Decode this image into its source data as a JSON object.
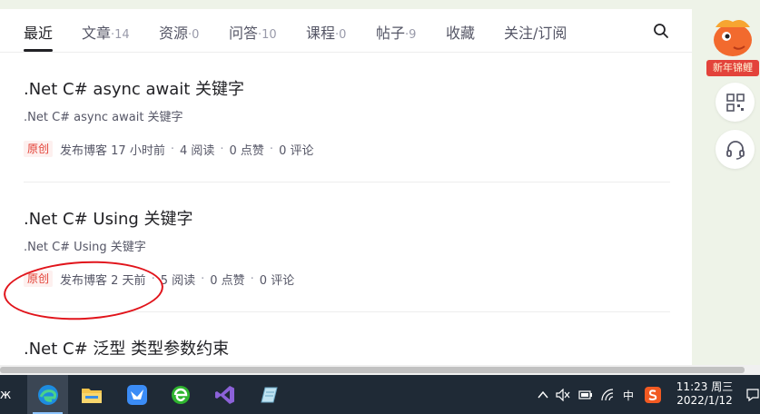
{
  "tabs": [
    {
      "label": "最近",
      "count": ""
    },
    {
      "label": "文章",
      "count": "·14"
    },
    {
      "label": "资源",
      "count": "·0"
    },
    {
      "label": "问答",
      "count": "·10"
    },
    {
      "label": "课程",
      "count": "·0"
    },
    {
      "label": "帖子",
      "count": "·9"
    },
    {
      "label": "收藏",
      "count": ""
    },
    {
      "label": "关注/订阅",
      "count": ""
    }
  ],
  "articles": [
    {
      "title": ".Net C# async await 关键字",
      "desc": ".Net C# async await 关键字",
      "badge": "原创",
      "published": "发布博客 17 小时前",
      "reads": "4 阅读",
      "likes": "0 点赞",
      "comments": "0 评论"
    },
    {
      "title": ".Net C# Using 关键字",
      "desc": ".Net C# Using 关键字",
      "badge": "原创",
      "published": "发布博客 2 天前",
      "reads": "5 阅读",
      "likes": "0 点赞",
      "comments": "0 评论"
    },
    {
      "title": ".Net C# 泛型 类型参数约束"
    }
  ],
  "side": {
    "promo_label": "新年锦鲤"
  },
  "taskbar": {
    "ime": "中",
    "time": "11:23 周三",
    "date": "2022/1/12",
    "left_edge": "ж"
  },
  "colors": {
    "badge_red": "#e33e33",
    "annotation_red": "#e1141b",
    "taskbar_bg": "#1f2a36"
  }
}
